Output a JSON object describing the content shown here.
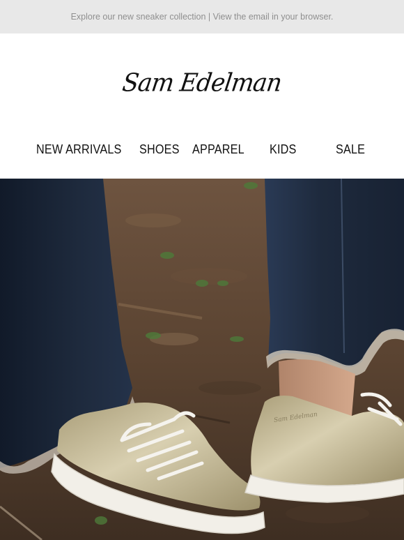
{
  "preheader": {
    "text": "Explore our new sneaker collection | View the email in your browser."
  },
  "brand": {
    "logo_text": "Sam Edelman"
  },
  "nav": {
    "items": [
      {
        "label": "NEW ARRIVALS"
      },
      {
        "label": "SHOES"
      },
      {
        "label": "APPAREL"
      },
      {
        "label": "KIDS"
      },
      {
        "label": "SALE"
      }
    ]
  },
  "hero": {
    "subject": "legs in frayed dark denim jeans wearing metallic gold lace-up sneakers on forest floor",
    "colors": {
      "ground": "#5a4331",
      "denim": "#1e2a3d",
      "sneaker": "#c9bd98",
      "sole": "#f2efe8"
    }
  }
}
